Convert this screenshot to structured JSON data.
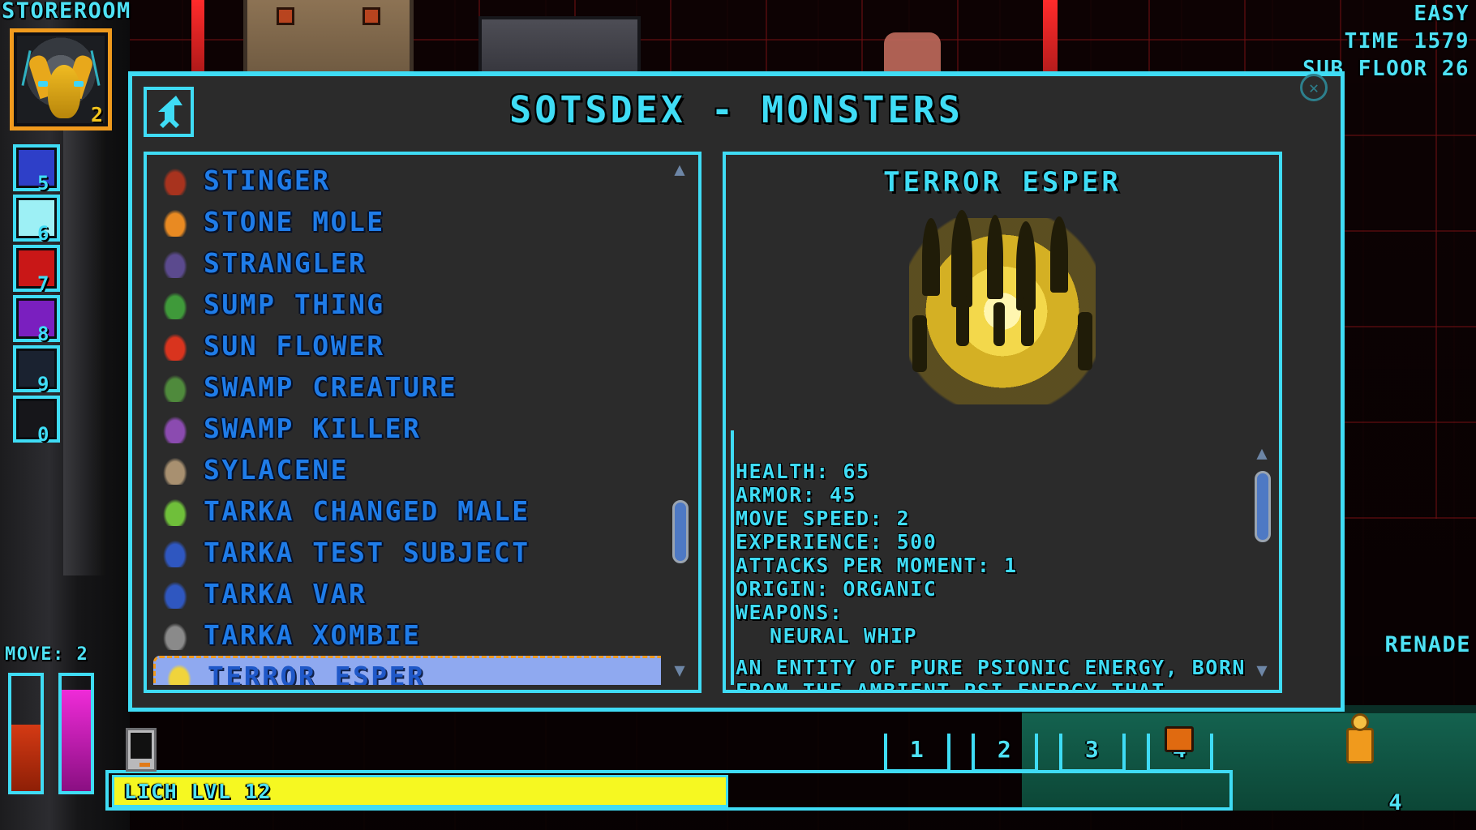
{
  "hud": {
    "room_label": "STOREROOM",
    "portrait_count": "2",
    "difficulty": "EASY",
    "time": "TIME 1579",
    "sub_floor": "SUB FLOOR 26",
    "move": "MOVE: 2",
    "lich_bar_label": "LICH LVL 12",
    "grenade_label": "RENADE",
    "right_count": "4",
    "hotbar": [
      {
        "num": "5",
        "icon": "blue-creature-icon",
        "color": "#2e3fc8"
      },
      {
        "num": "6",
        "icon": "ice-crystal-icon",
        "color": "#9df0f5"
      },
      {
        "num": "7",
        "icon": "red-demon-icon",
        "color": "#c91717"
      },
      {
        "num": "8",
        "icon": "purple-spider-icon",
        "color": "#7a1fbf"
      },
      {
        "num": "9",
        "icon": "white-spider-icon",
        "color": "#1a2230"
      },
      {
        "num": "0",
        "icon": "empty-slot-icon",
        "color": "#16161a"
      }
    ],
    "keycaps": [
      "1",
      "2",
      "3",
      "4"
    ]
  },
  "modal": {
    "title": "SOTSDEX - MONSTERS",
    "back_icon": "back-arrow-icon",
    "close_icon": "close-x-icon",
    "accent_color": "#3fdcf5",
    "panel_bg": "#2b2b2b",
    "list_text_color": "#1f7ce8",
    "selected_bg": "#8fa9f0",
    "selected_border": "#f09a1d"
  },
  "list": {
    "scroll_up_icon": "chevron-up-icon",
    "scroll_down_icon": "chevron-down-icon",
    "items": [
      {
        "label": "STINGER",
        "sprite": "stinger-sprite",
        "selected": false
      },
      {
        "label": "STONE MOLE",
        "sprite": "stone-mole-sprite",
        "selected": false
      },
      {
        "label": "STRANGLER",
        "sprite": "strangler-sprite",
        "selected": false
      },
      {
        "label": "SUMP THING",
        "sprite": "sump-thing-sprite",
        "selected": false
      },
      {
        "label": "SUN FLOWER",
        "sprite": "sun-flower-sprite",
        "selected": false
      },
      {
        "label": "SWAMP CREATURE",
        "sprite": "swamp-creature-sprite",
        "selected": false
      },
      {
        "label": "SWAMP KILLER",
        "sprite": "swamp-killer-sprite",
        "selected": false
      },
      {
        "label": "SYLACENE",
        "sprite": "sylacene-sprite",
        "selected": false
      },
      {
        "label": "TARKA CHANGED MALE",
        "sprite": "tarka-changed-male-sprite",
        "selected": false
      },
      {
        "label": "TARKA TEST SUBJECT",
        "sprite": "tarka-test-subject-sprite",
        "selected": false
      },
      {
        "label": "TARKA VAR",
        "sprite": "tarka-var-sprite",
        "selected": false
      },
      {
        "label": "TARKA XOMBIE",
        "sprite": "tarka-xombie-sprite",
        "selected": false
      },
      {
        "label": "TERROR ESPER",
        "sprite": "terror-esper-sprite",
        "selected": true
      }
    ]
  },
  "detail": {
    "title": "TERROR ESPER",
    "art": "terror-esper-portrait",
    "stats": [
      {
        "text": "HEALTH: 65",
        "indent": false
      },
      {
        "text": "ARMOR: 45",
        "indent": false
      },
      {
        "text": "MOVE SPEED: 2",
        "indent": false
      },
      {
        "text": "EXPERIENCE: 500",
        "indent": false
      },
      {
        "text": "ATTACKS PER MOMENT: 1",
        "indent": false
      },
      {
        "text": "ORIGIN: ORGANIC",
        "indent": false
      },
      {
        "text": "WEAPONS:",
        "indent": false
      },
      {
        "text": "NEURAL WHIP",
        "indent": true
      }
    ],
    "description": [
      "AN ENTITY OF PURE PSIONIC ENERGY, BORN",
      "FROM THE AMBIENT PSI-ENERGY THAT"
    ]
  }
}
